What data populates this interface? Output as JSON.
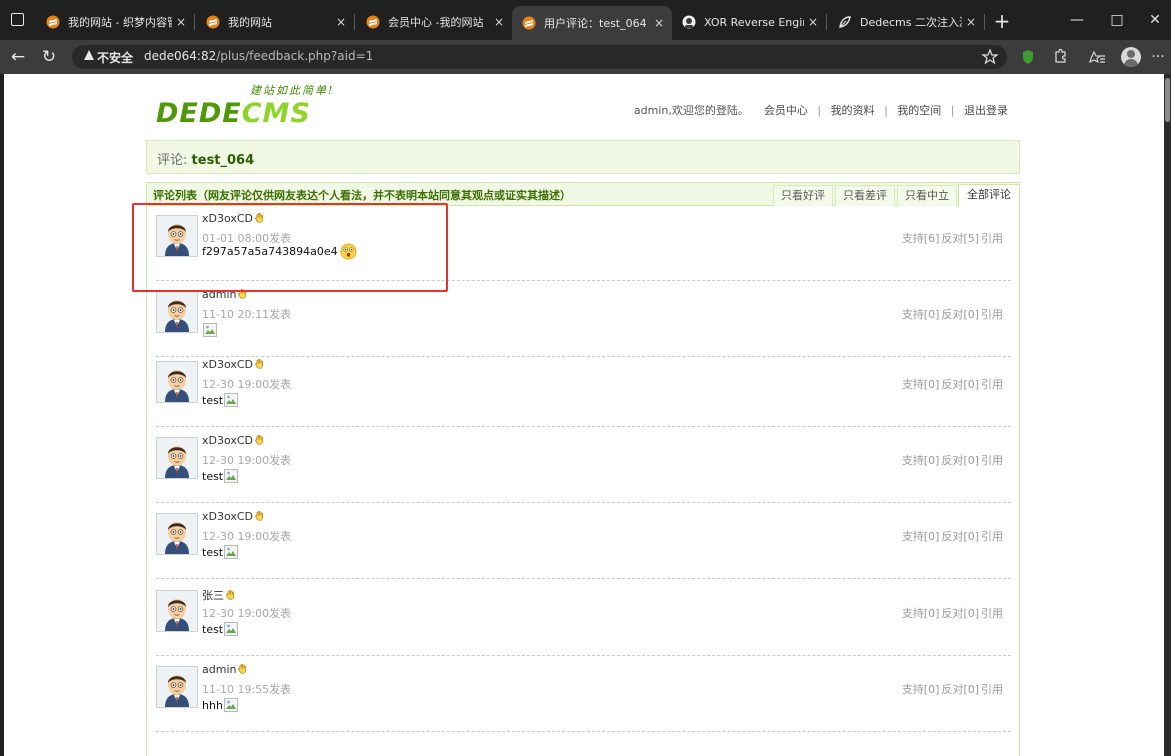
{
  "browser": {
    "tabs": [
      {
        "title": "我的网站 - 织梦内容管",
        "favicon": "dedecms-favicon",
        "active": false
      },
      {
        "title": "我的网站",
        "favicon": "dedecms-favicon",
        "active": false
      },
      {
        "title": "会员中心 -我的网站",
        "favicon": "dedecms-favicon",
        "active": false
      },
      {
        "title": "用户评论：test_064",
        "favicon": "dedecms-favicon",
        "active": true
      },
      {
        "title": "XOR Reverse Enginee",
        "favicon": "xor-favicon",
        "active": false
      },
      {
        "title": "Dedecms 二次注入漏",
        "favicon": "leaf-favicon",
        "active": false
      }
    ],
    "close_glyph": "×",
    "new_tab_glyph": "+",
    "window": {
      "minimize": "—",
      "maximize": "□",
      "close": "✕"
    },
    "nav": {
      "back": "←",
      "reload": "↻"
    },
    "security_label": "不安全",
    "url_host": "dede064:82",
    "url_path": "/plus/feedback.php?aid=1"
  },
  "page": {
    "logo": {
      "slogan": "建站如此简单!",
      "dede": "DEDE",
      "cms": "CMS"
    },
    "user_nav": {
      "greeting": "admin,欢迎您的登陆。",
      "links": [
        "会员中心",
        "我的资料",
        "我的空间",
        "退出登录"
      ]
    },
    "title_label": "评论:",
    "title_value": "test_064",
    "list_title": "评论列表（网友评论仅供网友表达个人看法，并不表明本站同意其观点或证实其描述）",
    "filters": [
      "只看好评",
      "只看差评",
      "只看中立",
      "全部评论"
    ],
    "active_filter": "全部评论",
    "comments": [
      {
        "user": "xD3oxCD",
        "time": "01-01 08:00发表",
        "text": "f297a57a5a743894a0e4",
        "media": "smiley",
        "support": "支持[6]",
        "oppose": "反对[5]",
        "quote": "引用"
      },
      {
        "user": "admin",
        "time": "11-10 20:11发表",
        "text": "",
        "media": "broken-image",
        "support": "支持[0]",
        "oppose": "反对[0]",
        "quote": "引用"
      },
      {
        "user": "xD3oxCD",
        "time": "12-30 19:00发表",
        "text": "test",
        "media": "broken-image",
        "support": "支持[0]",
        "oppose": "反对[0]",
        "quote": "引用"
      },
      {
        "user": "xD3oxCD",
        "time": "12-30 19:00发表",
        "text": "test",
        "media": "broken-image",
        "support": "支持[0]",
        "oppose": "反对[0]",
        "quote": "引用"
      },
      {
        "user": "xD3oxCD",
        "time": "12-30 19:00发表",
        "text": "test",
        "media": "broken-image",
        "support": "支持[0]",
        "oppose": "反对[0]",
        "quote": "引用"
      },
      {
        "user": "张三",
        "time": "12-30 19:00发表",
        "text": "test",
        "media": "broken-image",
        "support": "支持[0]",
        "oppose": "反对[0]",
        "quote": "引用"
      },
      {
        "user": "admin",
        "time": "11-10 19:55发表",
        "text": "hhh",
        "media": "broken-image",
        "support": "支持[0]",
        "oppose": "反对[0]",
        "quote": "引用"
      }
    ]
  },
  "colors": {
    "accent": "#4d9a06",
    "highlight": "#e8322e"
  }
}
